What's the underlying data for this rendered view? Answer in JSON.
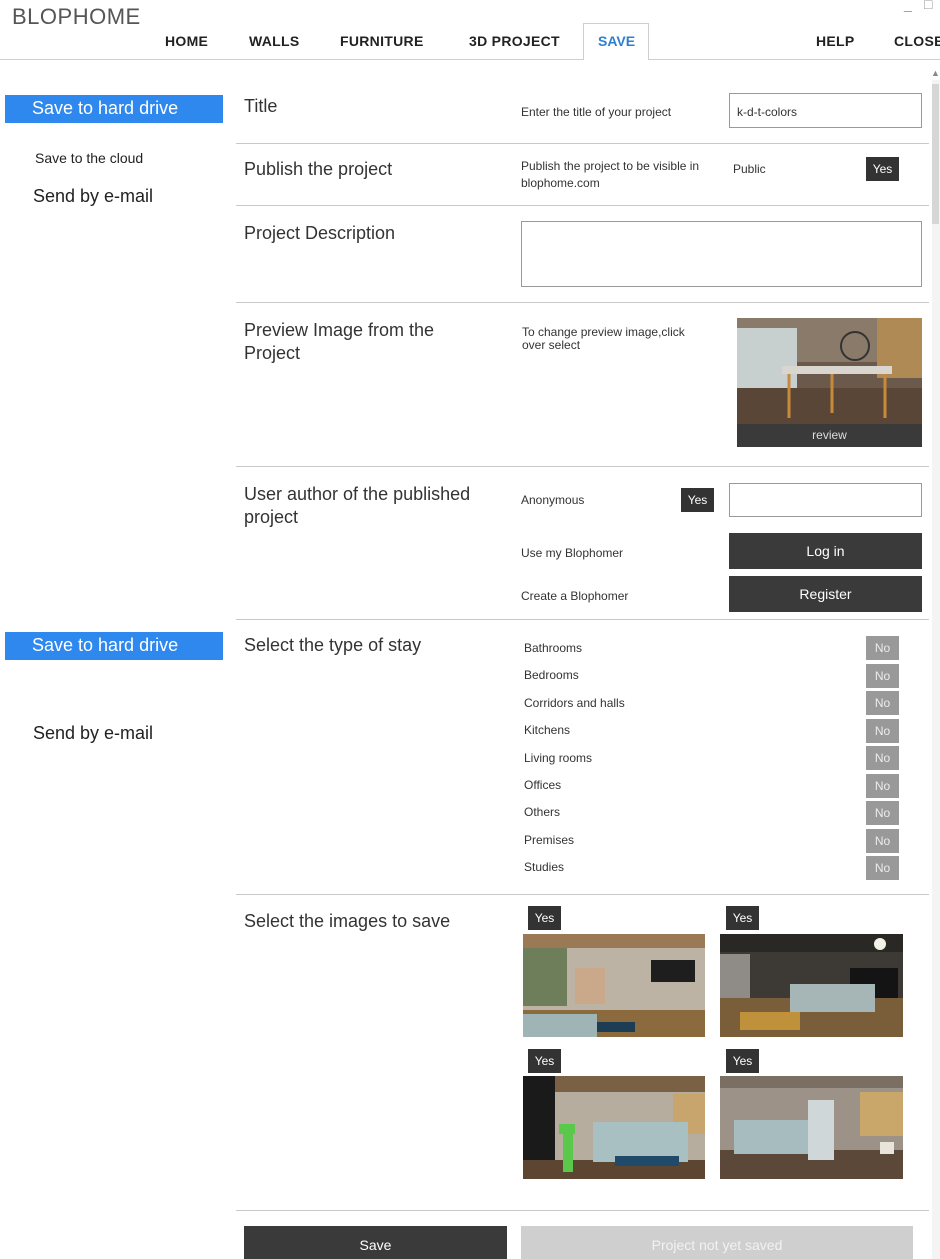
{
  "app": {
    "brand": "BLOPHOME",
    "window_controls": [
      "_",
      "□"
    ]
  },
  "nav": {
    "items": [
      "HOME",
      "WALLS",
      "FURNITURE",
      "3D PROJECT",
      "SAVE",
      "HELP",
      "CLOSE"
    ],
    "active": "SAVE",
    "accent_color": "#2f7fd0"
  },
  "left_menu": {
    "group1": [
      "Save to hard drive",
      "Save to the cloud",
      "Send by e-mail"
    ],
    "group2": [
      "Save to hard drive",
      "Send by e-mail"
    ],
    "active_color": "#2e88ee"
  },
  "title_section": {
    "title": "Title",
    "hint": "Enter the title of your project",
    "value": "k-d-t-colors"
  },
  "publish_section": {
    "title": "Publish the project",
    "hint_line1": "Publish the project to be visible in",
    "hint_line2": "blophome.com",
    "status": "Public",
    "button": "Yes"
  },
  "description_section": {
    "title": "Project Description",
    "value": ""
  },
  "preview_section": {
    "title_line1": "Preview Image from the",
    "title_line2": "Project",
    "hint_line1": "To change preview image,click",
    "hint_line2": "over select",
    "image_caption": "review"
  },
  "author_section": {
    "title_line1": "User author of the published",
    "title_line2": "project",
    "anonymous_label": "Anonymous",
    "anonymous_button": "Yes",
    "anonymous_value": "",
    "use_label": "Use my Blophomer",
    "login_button": "Log in",
    "create_label": "Create a Blophomer",
    "register_button": "Register"
  },
  "stay_section": {
    "title": "Select the type of stay",
    "types": [
      {
        "label": "Bathrooms",
        "value": "No"
      },
      {
        "label": "Bedrooms",
        "value": "No"
      },
      {
        "label": "Corridors and halls",
        "value": "No"
      },
      {
        "label": "Kitchens",
        "value": "No"
      },
      {
        "label": "Living rooms",
        "value": "No"
      },
      {
        "label": "Offices",
        "value": "No"
      },
      {
        "label": "Others",
        "value": "No"
      },
      {
        "label": "Premises",
        "value": "No"
      },
      {
        "label": "Studies",
        "value": "No"
      }
    ]
  },
  "images_section": {
    "title": "Select the images to save",
    "images": [
      {
        "selected": "Yes"
      },
      {
        "selected": "Yes"
      },
      {
        "selected": "Yes"
      },
      {
        "selected": "Yes"
      }
    ]
  },
  "footer": {
    "save_button": "Save",
    "status_button": "Project not yet saved"
  }
}
